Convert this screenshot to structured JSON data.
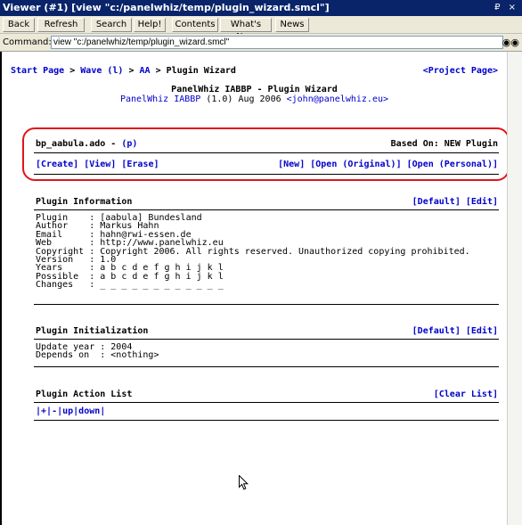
{
  "window": {
    "title": "Viewer (#1) [view \"c:/panelwhiz/temp/plugin_wizard.smcl\"]",
    "controls": "₽ ×"
  },
  "toolbar": {
    "buttons": [
      "Back",
      "Refresh",
      "Search",
      "Help!",
      "Contents",
      "What's New",
      "News"
    ]
  },
  "command": {
    "label": "Command:",
    "value": "view \"c:/panelwhiz/temp/plugin_wizard.smcl\""
  },
  "breadcrumb": {
    "start": "Start Page",
    "sep": " > ",
    "wave": "Wave (l)",
    "aa": "AA",
    "current": "Plugin Wizard",
    "project_link": "<Project Page>"
  },
  "header": {
    "title": "PanelWhiz IABBP - Plugin Wizard",
    "subtitle_link": "PanelWhiz IABBP",
    "subtitle_rest": " (1.0) Aug 2006 ",
    "email": "<john@panelwhiz.eu>"
  },
  "plugin_file": {
    "name": "bp_aabula.ado - ",
    "p_link": "(p)",
    "based_on": "Based On: NEW Plugin"
  },
  "file_actions_left": [
    "[Create]",
    "[View]",
    "[Erase]"
  ],
  "file_actions_right": [
    "[New]",
    "[Open (Original)]",
    "[Open (Personal)]"
  ],
  "info_section": {
    "title": "Plugin Information",
    "actions": [
      "[Default]",
      "[Edit]"
    ],
    "rows": [
      {
        "key": "Plugin",
        "value": "[aabula] Bundesland"
      },
      {
        "key": "Author",
        "value": "Markus Hahn"
      },
      {
        "key": "Email",
        "value": "hahn@rwi-essen.de"
      },
      {
        "key": "Web",
        "value": "http://www.panelwhiz.eu"
      },
      {
        "key": "Copyright",
        "value": "Copyright 2006. All rights reserved. Unauthorized copying prohibited."
      },
      {
        "key": "Version",
        "value": "1.0"
      },
      {
        "key": "Years",
        "value": "a b c d e f g h i j k l"
      },
      {
        "key": "Possible",
        "value": "a b c d e f g h i j k l"
      },
      {
        "key": "Changes",
        "value": "_ _ _ _ _ _ _ _ _ _ _ _"
      }
    ]
  },
  "init_section": {
    "title": "Plugin Initialization",
    "actions": [
      "[Default]",
      "[Edit]"
    ],
    "rows": [
      {
        "key": "Update year",
        "value": "2004"
      },
      {
        "key": "Depends on",
        "value": "<nothing>"
      }
    ]
  },
  "action_section": {
    "title": "Plugin Action List",
    "clear": "[Clear List]",
    "controls": [
      "|+|",
      "-|",
      "up|",
      "down|"
    ]
  },
  "colors": {
    "link": "#0000cc",
    "highlight": "#e1141b",
    "titlebar": "#0a246a"
  }
}
